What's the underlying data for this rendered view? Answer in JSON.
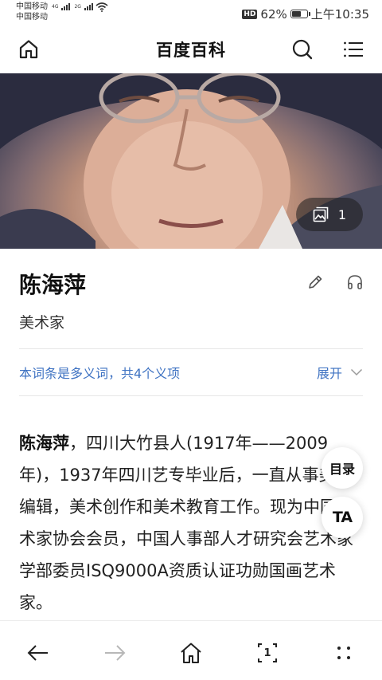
{
  "status_bar": {
    "carrier_1": "中国移动",
    "carrier_1_net": "4G",
    "carrier_2": "中国移动",
    "carrier_2_net": "2G",
    "hd_badge": "HD",
    "battery_text": "62%",
    "battery_level_percent": 62,
    "time": "上午10:35"
  },
  "nav": {
    "title": "百度百科",
    "home_icon": "home-icon",
    "search_icon": "search-icon",
    "menu_icon": "menu-icon"
  },
  "hero": {
    "photo_count": "1",
    "gallery_icon": "gallery-icon"
  },
  "entry": {
    "title": "陈海萍",
    "subtitle": "美术家",
    "edit_icon": "pencil-icon",
    "audio_icon": "headphones-icon",
    "polysemy_text": "本词条是多义词，共4个义项",
    "expand_label": "展开"
  },
  "body": {
    "lead_name": "陈海萍",
    "text": "，四川大竹县人(1917年——2009年)，1937年四川艺专毕业后，一直从事美术编辑，美术创作和美术教育工作。现为中国美术家协会会员，中国人事部人才研究会艺术家学部委员ISQ9000A资质认证功勋国画艺术家。"
  },
  "floating": {
    "toc_label": "目录",
    "ta_label": "TA"
  },
  "bottom_bar": {
    "back_icon": "back-arrow-icon",
    "forward_icon": "forward-arrow-icon",
    "home_icon": "home-icon",
    "tabs_count": "1",
    "more_icon": "more-dots-icon"
  },
  "colors": {
    "link_blue": "#3e72c2",
    "disabled_gray": "#b8b8b8"
  }
}
